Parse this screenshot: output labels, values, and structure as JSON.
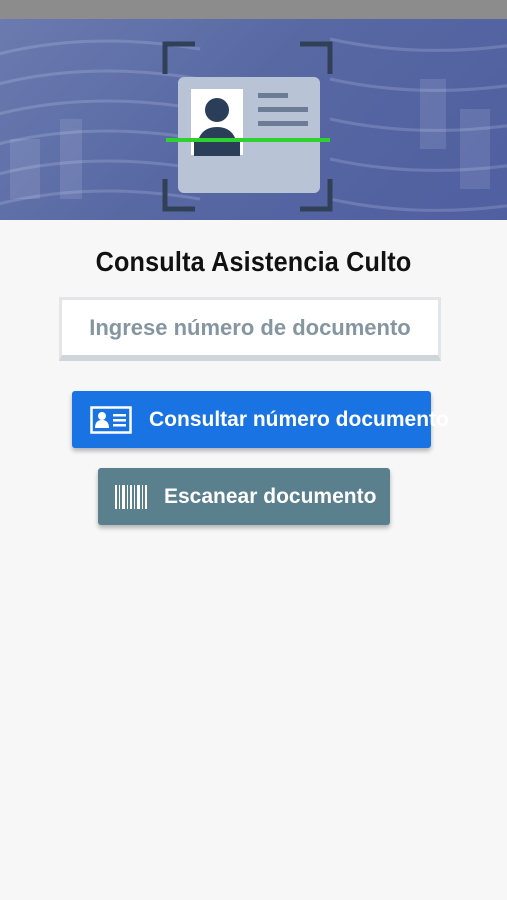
{
  "header": {
    "title": "Consulta Asistencia Culto"
  },
  "document_input": {
    "value": "",
    "placeholder": "Ingrese número de documento"
  },
  "buttons": {
    "consult": {
      "label": "Consultar número documento",
      "icon": "id-card-icon",
      "color": "#1a73e3"
    },
    "scan": {
      "label": "Escanear documento",
      "icon": "barcode-icon",
      "color": "#5a7f8d"
    }
  },
  "colors": {
    "hero_background": "#5868a3",
    "scan_line": "#2fd12f",
    "page_background": "#f7f7f8"
  }
}
